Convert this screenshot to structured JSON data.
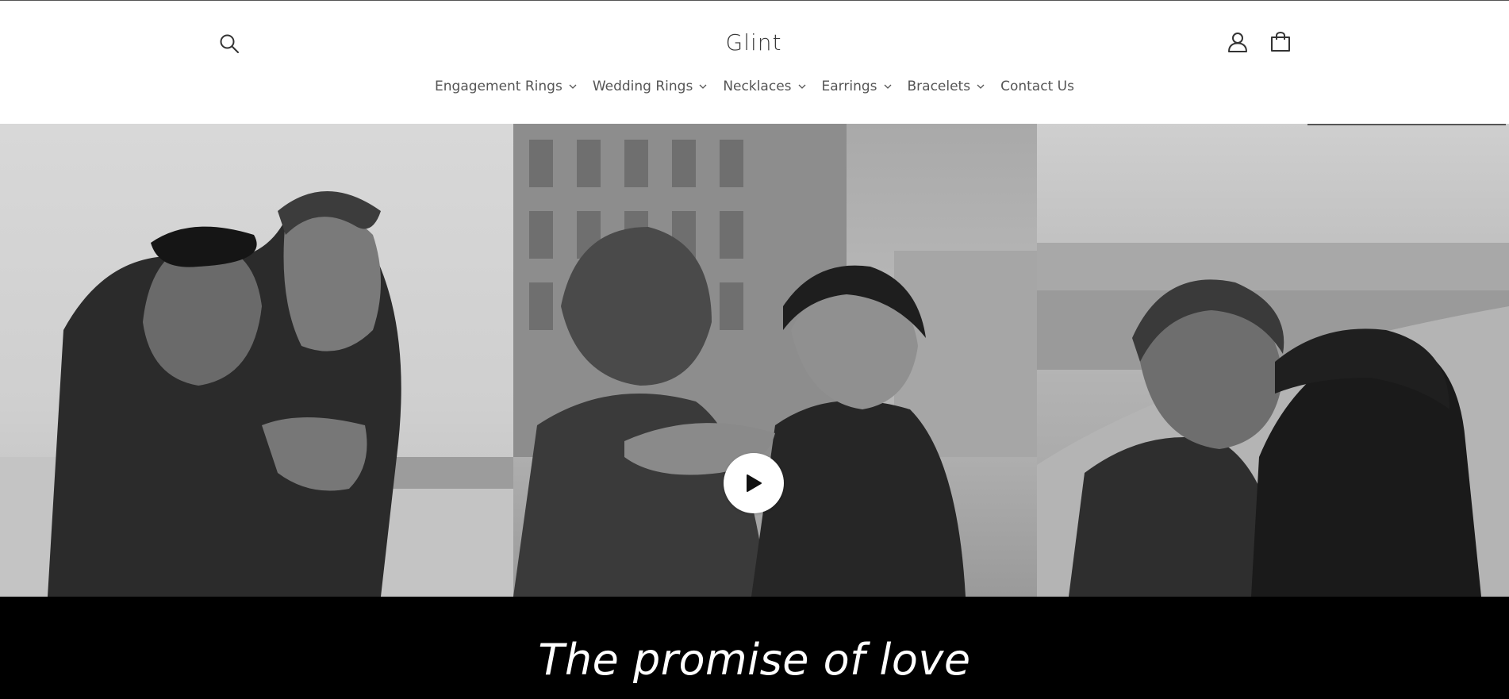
{
  "header": {
    "logo": "Glint",
    "icons": {
      "search": "search-icon",
      "account": "account-icon",
      "cart": "cart-icon"
    }
  },
  "nav": {
    "items": [
      {
        "label": "Engagement Rings",
        "has_dropdown": true
      },
      {
        "label": "Wedding Rings",
        "has_dropdown": true
      },
      {
        "label": "Necklaces",
        "has_dropdown": true
      },
      {
        "label": "Earrings",
        "has_dropdown": true
      },
      {
        "label": "Bracelets",
        "has_dropdown": true
      },
      {
        "label": "Contact Us",
        "has_dropdown": false
      }
    ]
  },
  "hero": {
    "media": "video",
    "play_icon": "play-icon"
  },
  "banner": {
    "title": "The promise of love",
    "background": "#000000",
    "text_color": "#ffffff"
  }
}
